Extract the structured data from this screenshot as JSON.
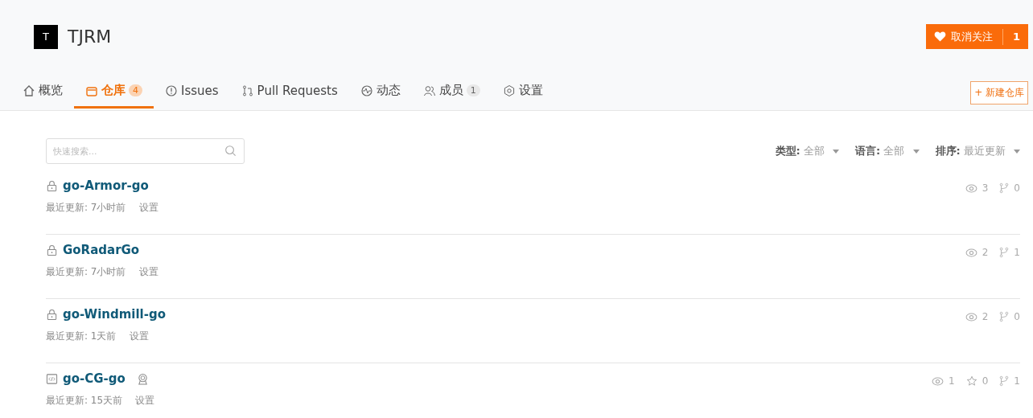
{
  "org": {
    "avatar_letter": "T",
    "name": "TJRM"
  },
  "follow_button": {
    "label": "取消关注",
    "count": "1"
  },
  "tabs": [
    {
      "kind": "overview",
      "label": "概览",
      "selected": false
    },
    {
      "kind": "repos",
      "label": "仓库",
      "count": "4",
      "selected": true
    },
    {
      "kind": "issues",
      "label": "Issues",
      "selected": false
    },
    {
      "kind": "pulls",
      "label": "Pull Requests",
      "selected": false
    },
    {
      "kind": "activity",
      "label": "动态",
      "selected": false
    },
    {
      "kind": "members",
      "label": "成员",
      "count": "1",
      "selected": false
    },
    {
      "kind": "settings",
      "label": "设置",
      "selected": false
    }
  ],
  "new_repo_button": "+ 新建仓库",
  "search": {
    "placeholder": "快速搜索..."
  },
  "filters": [
    {
      "label": "类型:",
      "value": "全部"
    },
    {
      "label": "语言:",
      "value": "全部"
    },
    {
      "label": "排序:",
      "value": "最近更新"
    }
  ],
  "repos": [
    {
      "kind": "private",
      "name": "go-Armor-go",
      "badge": false,
      "updated": "最近更新: 7小时前",
      "settings": "设置",
      "stats": [
        {
          "kind": "watch",
          "value": "3"
        },
        {
          "kind": "fork",
          "value": "0"
        }
      ]
    },
    {
      "kind": "private",
      "name": "GoRadarGo",
      "badge": false,
      "updated": "最近更新: 7小时前",
      "settings": "设置",
      "stats": [
        {
          "kind": "watch",
          "value": "2"
        },
        {
          "kind": "fork",
          "value": "1"
        }
      ]
    },
    {
      "kind": "private",
      "name": "go-Windmill-go",
      "badge": false,
      "updated": "最近更新: 1天前",
      "settings": "设置",
      "stats": [
        {
          "kind": "watch",
          "value": "2"
        },
        {
          "kind": "fork",
          "value": "0"
        }
      ]
    },
    {
      "kind": "public",
      "name": "go-CG-go",
      "badge": true,
      "updated": "最近更新: 15天前",
      "settings": "设置",
      "stats": [
        {
          "kind": "watch",
          "value": "1"
        },
        {
          "kind": "star",
          "value": "0"
        },
        {
          "kind": "fork",
          "value": "1"
        }
      ]
    }
  ]
}
